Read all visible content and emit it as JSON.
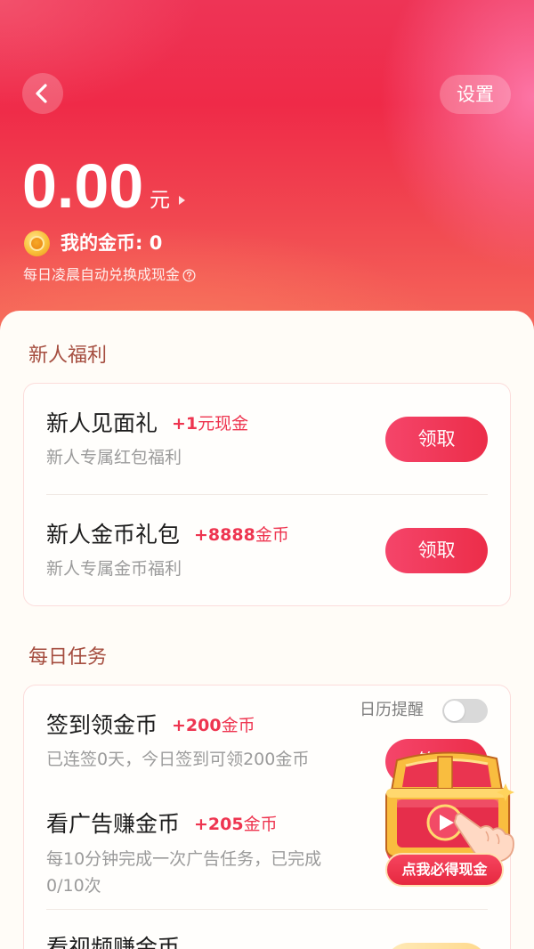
{
  "header": {
    "back_icon": "chevron-left-icon",
    "settings_label": "设置",
    "balance": "0.00",
    "balance_unit": "元",
    "coin_icon": "coin-icon",
    "coins_label": "我的金币: 0",
    "exchange_note": "每日凌晨自动兑换成现金",
    "help_icon": "question-circle-icon"
  },
  "newbie": {
    "title": "新人福利",
    "items": [
      {
        "title": "新人见面礼",
        "reward_amount": "+1",
        "reward_unit": "元现金",
        "desc": "新人专属红包福利",
        "button": "领取"
      },
      {
        "title": "新人金币礼包",
        "reward_amount": "+8888",
        "reward_unit": "金币",
        "desc": "新人专属金币福利",
        "button": "领取"
      }
    ]
  },
  "daily": {
    "title": "每日任务",
    "items": [
      {
        "title": "签到领金币",
        "reward_amount": "+200",
        "reward_unit": "金币",
        "desc": "已连签0天，今日签到可领200金币",
        "button": "签到",
        "reminder_label": "日历提醒",
        "reminder_enabled": false
      },
      {
        "title": "看广告赚金币",
        "reward_amount": "+205",
        "reward_unit": "金币",
        "desc_lines": [
          "每10分钟完成一次广告任务，已完成",
          "0/10次"
        ]
      },
      {
        "title": "看视频赚金币"
      }
    ]
  },
  "floating_promo": {
    "icon": "treasure-chest-icon",
    "label": "点我必得现金"
  },
  "colors": {
    "header_red": "#ef2a48",
    "accent": "#ec2d49",
    "reward": "#ee3550",
    "section_title": "#a54d3f",
    "page_bg": "#fffcf7"
  }
}
